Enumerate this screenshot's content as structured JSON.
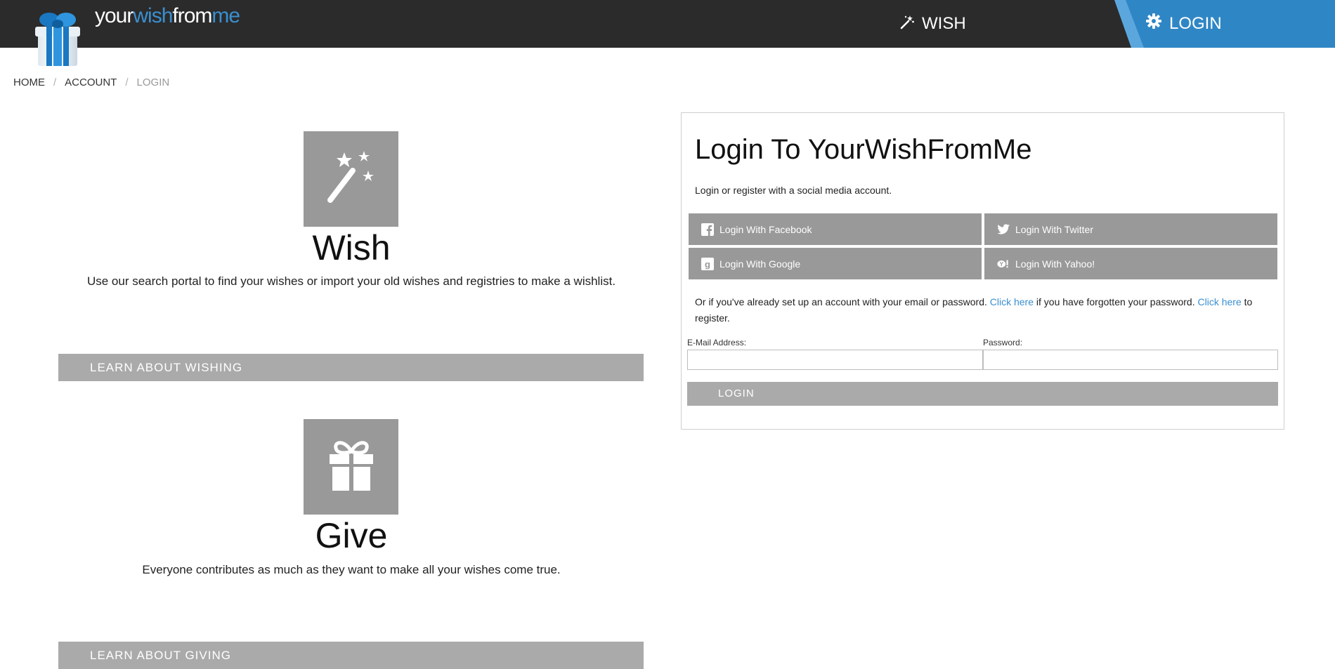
{
  "header": {
    "brand": {
      "part1": "your",
      "part2": "wish",
      "part3": "from",
      "part4": "me"
    },
    "nav": {
      "wish_label": "WISH",
      "login_label": "LOGIN"
    },
    "colors": {
      "bar": "#2b2b2b",
      "accent": "#2f86c5",
      "accent_light": "#5ba7dd"
    }
  },
  "breadcrumb": {
    "items": [
      "HOME",
      "ACCOUNT",
      "LOGIN"
    ],
    "separator": "/"
  },
  "features": [
    {
      "icon": "magic-wand-icon",
      "title": "Wish",
      "description": "Use our search portal to find your wishes or import your old wishes and registries to make a wishlist.",
      "learn_label": "LEARN ABOUT WISHING"
    },
    {
      "icon": "gift-icon",
      "title": "Give",
      "description": "Everyone contributes as much as they want to make all your wishes come true.",
      "learn_label": "LEARN ABOUT GIVING"
    }
  ],
  "login_panel": {
    "title": "Login To YourWishFromMe",
    "subtitle": "Login or register with a social media account.",
    "social": [
      {
        "label": "Login With Facebook",
        "icon": "facebook-icon"
      },
      {
        "label": "Login With Twitter",
        "icon": "twitter-icon"
      },
      {
        "label": "Login With Google",
        "icon": "google-icon"
      },
      {
        "label": "Login With Yahoo!",
        "icon": "yahoo-icon"
      }
    ],
    "info": {
      "part1": "Or if you've already set up an account with your email or password. ",
      "link1": "Click here",
      "part2": " if you have forgotten your password. ",
      "link2": "Click here",
      "part3": " to register."
    },
    "email_label": "E-Mail Address:",
    "email_value": "",
    "password_label": "Password:",
    "password_value": "",
    "login_button": "LOGIN"
  }
}
